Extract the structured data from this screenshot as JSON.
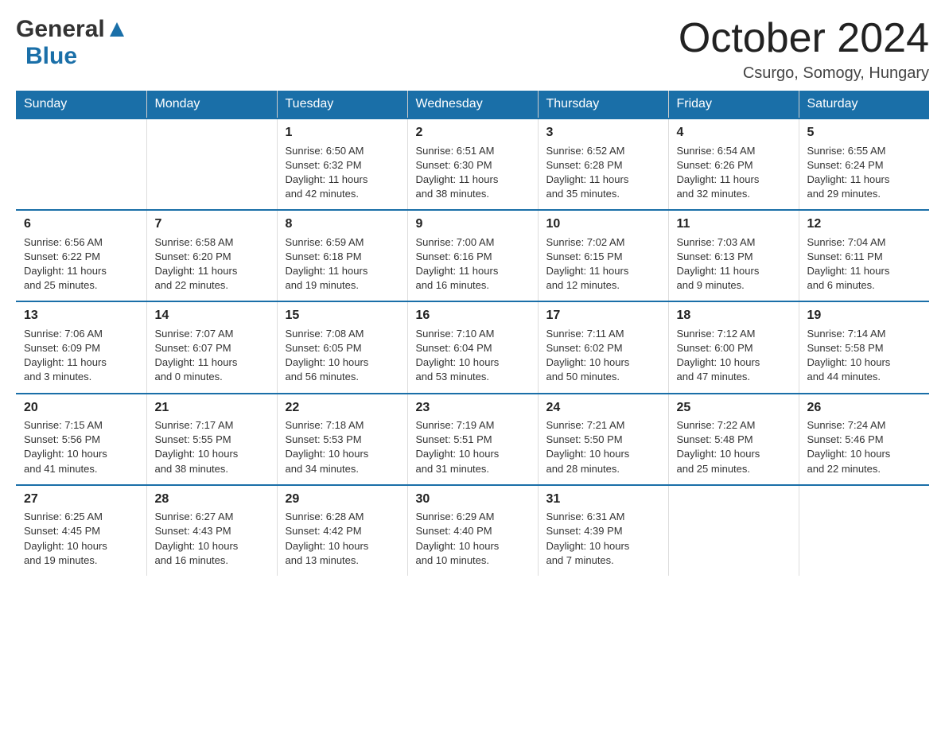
{
  "header": {
    "title": "October 2024",
    "location": "Csurgo, Somogy, Hungary"
  },
  "weekdays": [
    "Sunday",
    "Monday",
    "Tuesday",
    "Wednesday",
    "Thursday",
    "Friday",
    "Saturday"
  ],
  "weeks": [
    [
      {
        "day": "",
        "info": ""
      },
      {
        "day": "",
        "info": ""
      },
      {
        "day": "1",
        "info": "Sunrise: 6:50 AM\nSunset: 6:32 PM\nDaylight: 11 hours\nand 42 minutes."
      },
      {
        "day": "2",
        "info": "Sunrise: 6:51 AM\nSunset: 6:30 PM\nDaylight: 11 hours\nand 38 minutes."
      },
      {
        "day": "3",
        "info": "Sunrise: 6:52 AM\nSunset: 6:28 PM\nDaylight: 11 hours\nand 35 minutes."
      },
      {
        "day": "4",
        "info": "Sunrise: 6:54 AM\nSunset: 6:26 PM\nDaylight: 11 hours\nand 32 minutes."
      },
      {
        "day": "5",
        "info": "Sunrise: 6:55 AM\nSunset: 6:24 PM\nDaylight: 11 hours\nand 29 minutes."
      }
    ],
    [
      {
        "day": "6",
        "info": "Sunrise: 6:56 AM\nSunset: 6:22 PM\nDaylight: 11 hours\nand 25 minutes."
      },
      {
        "day": "7",
        "info": "Sunrise: 6:58 AM\nSunset: 6:20 PM\nDaylight: 11 hours\nand 22 minutes."
      },
      {
        "day": "8",
        "info": "Sunrise: 6:59 AM\nSunset: 6:18 PM\nDaylight: 11 hours\nand 19 minutes."
      },
      {
        "day": "9",
        "info": "Sunrise: 7:00 AM\nSunset: 6:16 PM\nDaylight: 11 hours\nand 16 minutes."
      },
      {
        "day": "10",
        "info": "Sunrise: 7:02 AM\nSunset: 6:15 PM\nDaylight: 11 hours\nand 12 minutes."
      },
      {
        "day": "11",
        "info": "Sunrise: 7:03 AM\nSunset: 6:13 PM\nDaylight: 11 hours\nand 9 minutes."
      },
      {
        "day": "12",
        "info": "Sunrise: 7:04 AM\nSunset: 6:11 PM\nDaylight: 11 hours\nand 6 minutes."
      }
    ],
    [
      {
        "day": "13",
        "info": "Sunrise: 7:06 AM\nSunset: 6:09 PM\nDaylight: 11 hours\nand 3 minutes."
      },
      {
        "day": "14",
        "info": "Sunrise: 7:07 AM\nSunset: 6:07 PM\nDaylight: 11 hours\nand 0 minutes."
      },
      {
        "day": "15",
        "info": "Sunrise: 7:08 AM\nSunset: 6:05 PM\nDaylight: 10 hours\nand 56 minutes."
      },
      {
        "day": "16",
        "info": "Sunrise: 7:10 AM\nSunset: 6:04 PM\nDaylight: 10 hours\nand 53 minutes."
      },
      {
        "day": "17",
        "info": "Sunrise: 7:11 AM\nSunset: 6:02 PM\nDaylight: 10 hours\nand 50 minutes."
      },
      {
        "day": "18",
        "info": "Sunrise: 7:12 AM\nSunset: 6:00 PM\nDaylight: 10 hours\nand 47 minutes."
      },
      {
        "day": "19",
        "info": "Sunrise: 7:14 AM\nSunset: 5:58 PM\nDaylight: 10 hours\nand 44 minutes."
      }
    ],
    [
      {
        "day": "20",
        "info": "Sunrise: 7:15 AM\nSunset: 5:56 PM\nDaylight: 10 hours\nand 41 minutes."
      },
      {
        "day": "21",
        "info": "Sunrise: 7:17 AM\nSunset: 5:55 PM\nDaylight: 10 hours\nand 38 minutes."
      },
      {
        "day": "22",
        "info": "Sunrise: 7:18 AM\nSunset: 5:53 PM\nDaylight: 10 hours\nand 34 minutes."
      },
      {
        "day": "23",
        "info": "Sunrise: 7:19 AM\nSunset: 5:51 PM\nDaylight: 10 hours\nand 31 minutes."
      },
      {
        "day": "24",
        "info": "Sunrise: 7:21 AM\nSunset: 5:50 PM\nDaylight: 10 hours\nand 28 minutes."
      },
      {
        "day": "25",
        "info": "Sunrise: 7:22 AM\nSunset: 5:48 PM\nDaylight: 10 hours\nand 25 minutes."
      },
      {
        "day": "26",
        "info": "Sunrise: 7:24 AM\nSunset: 5:46 PM\nDaylight: 10 hours\nand 22 minutes."
      }
    ],
    [
      {
        "day": "27",
        "info": "Sunrise: 6:25 AM\nSunset: 4:45 PM\nDaylight: 10 hours\nand 19 minutes."
      },
      {
        "day": "28",
        "info": "Sunrise: 6:27 AM\nSunset: 4:43 PM\nDaylight: 10 hours\nand 16 minutes."
      },
      {
        "day": "29",
        "info": "Sunrise: 6:28 AM\nSunset: 4:42 PM\nDaylight: 10 hours\nand 13 minutes."
      },
      {
        "day": "30",
        "info": "Sunrise: 6:29 AM\nSunset: 4:40 PM\nDaylight: 10 hours\nand 10 minutes."
      },
      {
        "day": "31",
        "info": "Sunrise: 6:31 AM\nSunset: 4:39 PM\nDaylight: 10 hours\nand 7 minutes."
      },
      {
        "day": "",
        "info": ""
      },
      {
        "day": "",
        "info": ""
      }
    ]
  ]
}
